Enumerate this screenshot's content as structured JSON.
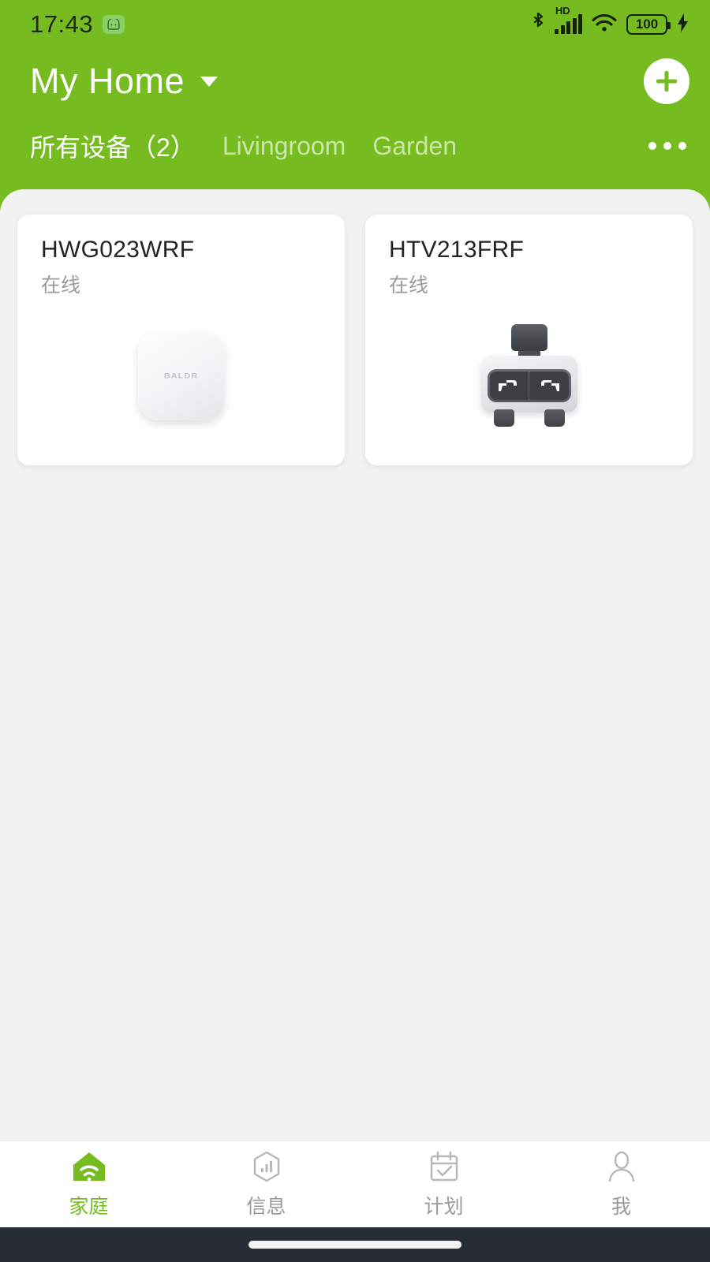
{
  "status_bar": {
    "time": "17:43",
    "notification_icon": "android-face-icon",
    "bluetooth_icon": "bluetooth-icon",
    "hd_label": "HD",
    "signal_icon": "signal-bars-icon",
    "wifi_icon": "wifi-icon",
    "battery_level": "100",
    "charging_icon": "charging-bolt-icon"
  },
  "header": {
    "home_name": "My Home",
    "dropdown_icon": "chevron-down-icon",
    "add_label": "+",
    "add_icon": "plus-icon"
  },
  "tabs": {
    "items": [
      {
        "label": "所有设备（2）",
        "active": true
      },
      {
        "label": "Livingroom",
        "active": false
      },
      {
        "label": "Garden",
        "active": false
      }
    ],
    "overflow_icon": "more-horizontal-icon"
  },
  "devices": [
    {
      "name": "HWG023WRF",
      "status": "在线",
      "art": "gateway-hub",
      "logo": "BALDR"
    },
    {
      "name": "HTV213FRF",
      "status": "在线",
      "art": "water-valve-timer"
    }
  ],
  "bottom_nav": {
    "items": [
      {
        "label": "家庭",
        "icon": "home-wifi-icon",
        "active": true
      },
      {
        "label": "信息",
        "icon": "info-chart-icon",
        "active": false
      },
      {
        "label": "计划",
        "icon": "calendar-check-icon",
        "active": false
      },
      {
        "label": "我",
        "icon": "user-profile-icon",
        "active": false
      }
    ]
  },
  "colors": {
    "brand_green": "#76bc21",
    "panel_bg": "#f1f1f1",
    "card_bg": "#ffffff",
    "muted_text": "#9b9b9b",
    "gesture_bar": "#272c37"
  }
}
